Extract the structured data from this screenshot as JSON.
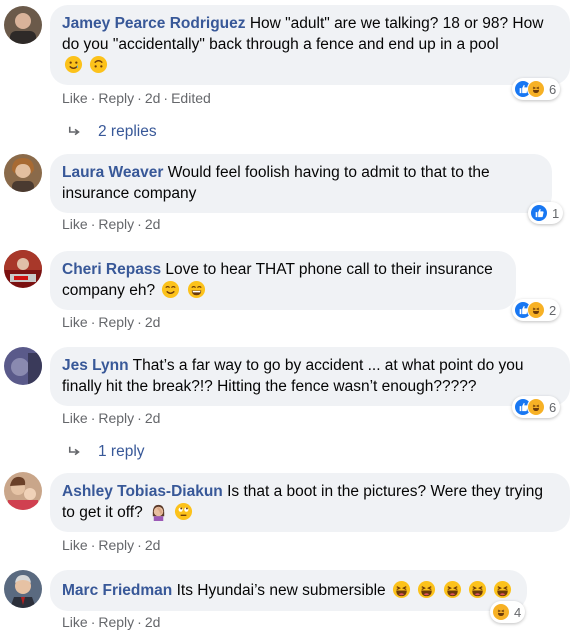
{
  "actions": {
    "like": "Like",
    "reply": "Reply",
    "dot": "·"
  },
  "comments": [
    {
      "name": "Jamey Pearce Rodriguez",
      "text": "How \"adult\" are we talking? 18 or 98? How do you \"accidentally\" back through a fence and end up in a pool",
      "time": "2d",
      "edited": "Edited",
      "reactions": [
        "like",
        "haha"
      ],
      "reaction_count": "6",
      "emoji": [
        "tear-smile",
        "upside-down-face"
      ]
    },
    {
      "name": "Laura Weaver",
      "text": "Would feel foolish having to admit to that to the insurance company",
      "time": "2d",
      "reactions": [
        "like"
      ],
      "reaction_count": "1"
    },
    {
      "name": "Cheri Repass",
      "text": "Love to hear THAT phone call to their insurance company eh?",
      "time": "2d",
      "reactions": [
        "like",
        "haha"
      ],
      "reaction_count": "2",
      "emoji": [
        "smiling-face",
        "grinning-face"
      ]
    },
    {
      "name": "Jes Lynn",
      "text": "That’s a far way to go by accident ... at what point do you finally hit the break?!? Hitting the fence wasn’t enough?????",
      "time": "2d",
      "reactions": [
        "like",
        "haha"
      ],
      "reaction_count": "6"
    },
    {
      "name": "Ashley Tobias-Diakun",
      "text": "Is that a boot in the pictures? Were they trying to get it off?",
      "time": "2d",
      "emoji": [
        "facepalm",
        "eye-roll-face"
      ]
    },
    {
      "name": "Marc Friedman",
      "text": "Its Hyundai’s new submersible",
      "time": "2d",
      "reactions": [
        "haha"
      ],
      "reaction_count": "4",
      "emoji": [
        "laughing-face",
        "laughing-face",
        "laughing-face",
        "laughing-face",
        "laughing-face"
      ]
    }
  ],
  "reply_links": [
    "2 replies",
    "1 reply"
  ],
  "colors": {
    "name": "#385898",
    "bubble": "#f0f2f5",
    "meta": "#65676b",
    "like": "#1877f2",
    "haha": "#f7b125"
  }
}
